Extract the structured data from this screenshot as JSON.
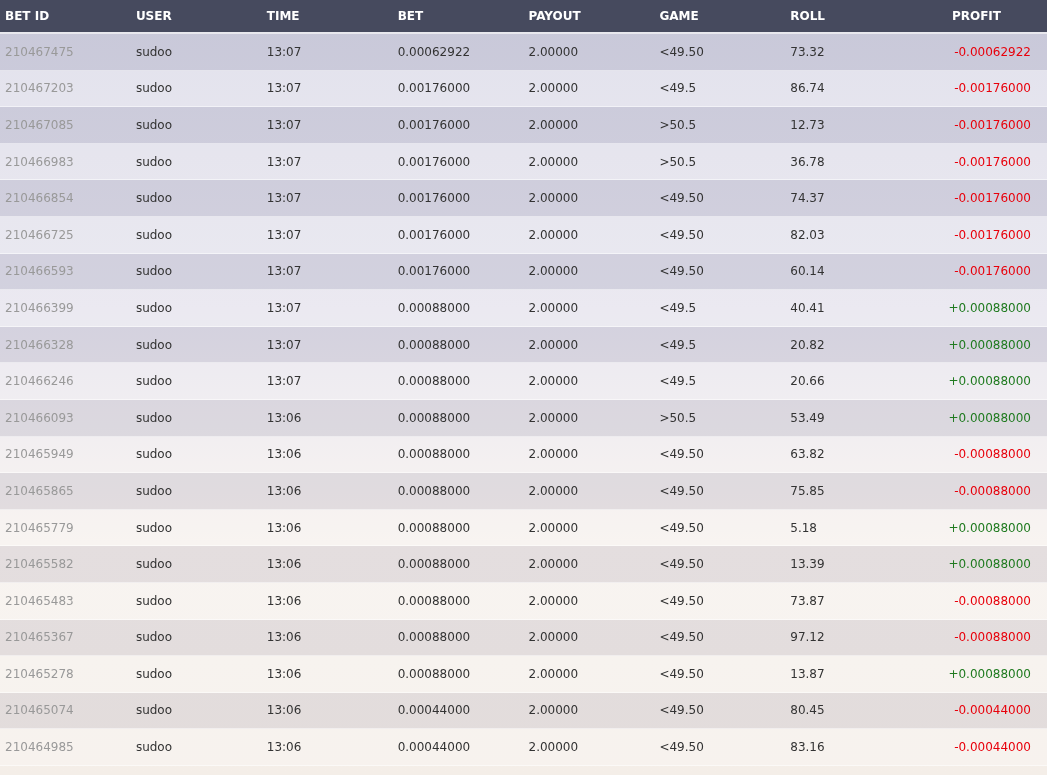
{
  "table": {
    "columns": [
      "BET ID",
      "USER",
      "TIME",
      "BET",
      "PAYOUT",
      "GAME",
      "ROLL",
      "PROFIT"
    ],
    "rows": [
      {
        "cells": [
          "210467475",
          "sudoo",
          "13:07",
          "0.00062922",
          "2.00000",
          "<49.50",
          "73.32",
          "-0.00062922"
        ],
        "color": "#e8000b"
      },
      {
        "cells": [
          "210467203",
          "sudoo",
          "13:07",
          "0.00176000",
          "2.00000",
          "<49.5",
          "86.74",
          "-0.00176000"
        ],
        "color": "#e8000b"
      },
      {
        "cells": [
          "210467085",
          "sudoo",
          "13:07",
          "0.00176000",
          "2.00000",
          ">50.5",
          "12.73",
          "-0.00176000"
        ],
        "color": "#e8000b"
      },
      {
        "cells": [
          "210466983",
          "sudoo",
          "13:07",
          "0.00176000",
          "2.00000",
          ">50.5",
          "36.78",
          "-0.00176000"
        ],
        "color": "#e8000b"
      },
      {
        "cells": [
          "210466854",
          "sudoo",
          "13:07",
          "0.00176000",
          "2.00000",
          "<49.50",
          "74.37",
          "-0.00176000"
        ],
        "color": "#e8000b"
      },
      {
        "cells": [
          "210466725",
          "sudoo",
          "13:07",
          "0.00176000",
          "2.00000",
          "<49.50",
          "82.03",
          "-0.00176000"
        ],
        "color": "#e8000b"
      },
      {
        "cells": [
          "210466593",
          "sudoo",
          "13:07",
          "0.00176000",
          "2.00000",
          "<49.50",
          "60.14",
          "-0.00176000"
        ],
        "color": "#e8000b"
      },
      {
        "cells": [
          "210466399",
          "sudoo",
          "13:07",
          "0.00088000",
          "2.00000",
          "<49.5",
          "40.41",
          "+0.00088000"
        ],
        "color": "#1f7a1f"
      },
      {
        "cells": [
          "210466328",
          "sudoo",
          "13:07",
          "0.00088000",
          "2.00000",
          "<49.5",
          "20.82",
          "+0.00088000"
        ],
        "color": "#1f7a1f"
      },
      {
        "cells": [
          "210466246",
          "sudoo",
          "13:07",
          "0.00088000",
          "2.00000",
          "<49.5",
          "20.66",
          "+0.00088000"
        ],
        "color": "#1f7a1f"
      },
      {
        "cells": [
          "210466093",
          "sudoo",
          "13:06",
          "0.00088000",
          "2.00000",
          ">50.5",
          "53.49",
          "+0.00088000"
        ],
        "color": "#1f7a1f"
      },
      {
        "cells": [
          "210465949",
          "sudoo",
          "13:06",
          "0.00088000",
          "2.00000",
          "<49.50",
          "63.82",
          "-0.00088000"
        ],
        "color": "#e8000b"
      },
      {
        "cells": [
          "210465865",
          "sudoo",
          "13:06",
          "0.00088000",
          "2.00000",
          "<49.50",
          "75.85",
          "-0.00088000"
        ],
        "color": "#e8000b"
      },
      {
        "cells": [
          "210465779",
          "sudoo",
          "13:06",
          "0.00088000",
          "2.00000",
          "<49.50",
          "5.18",
          "+0.00088000"
        ],
        "color": "#1f7a1f"
      },
      {
        "cells": [
          "210465582",
          "sudoo",
          "13:06",
          "0.00088000",
          "2.00000",
          "<49.50",
          "13.39",
          "+0.00088000"
        ],
        "color": "#1f7a1f"
      },
      {
        "cells": [
          "210465483",
          "sudoo",
          "13:06",
          "0.00088000",
          "2.00000",
          "<49.50",
          "73.87",
          "-0.00088000"
        ],
        "color": "#e8000b"
      },
      {
        "cells": [
          "210465367",
          "sudoo",
          "13:06",
          "0.00088000",
          "2.00000",
          "<49.50",
          "97.12",
          "-0.00088000"
        ],
        "color": "#e8000b"
      },
      {
        "cells": [
          "210465278",
          "sudoo",
          "13:06",
          "0.00088000",
          "2.00000",
          "<49.50",
          "13.87",
          "+0.00088000"
        ],
        "color": "#1f7a1f"
      },
      {
        "cells": [
          "210465074",
          "sudoo",
          "13:06",
          "0.00044000",
          "2.00000",
          "<49.50",
          "80.45",
          "-0.00044000"
        ],
        "color": "#e8000b"
      },
      {
        "cells": [
          "210464985",
          "sudoo",
          "13:06",
          "0.00044000",
          "2.00000",
          "<49.50",
          "83.16",
          "-0.00044000"
        ],
        "color": "#e8000b"
      }
    ]
  }
}
